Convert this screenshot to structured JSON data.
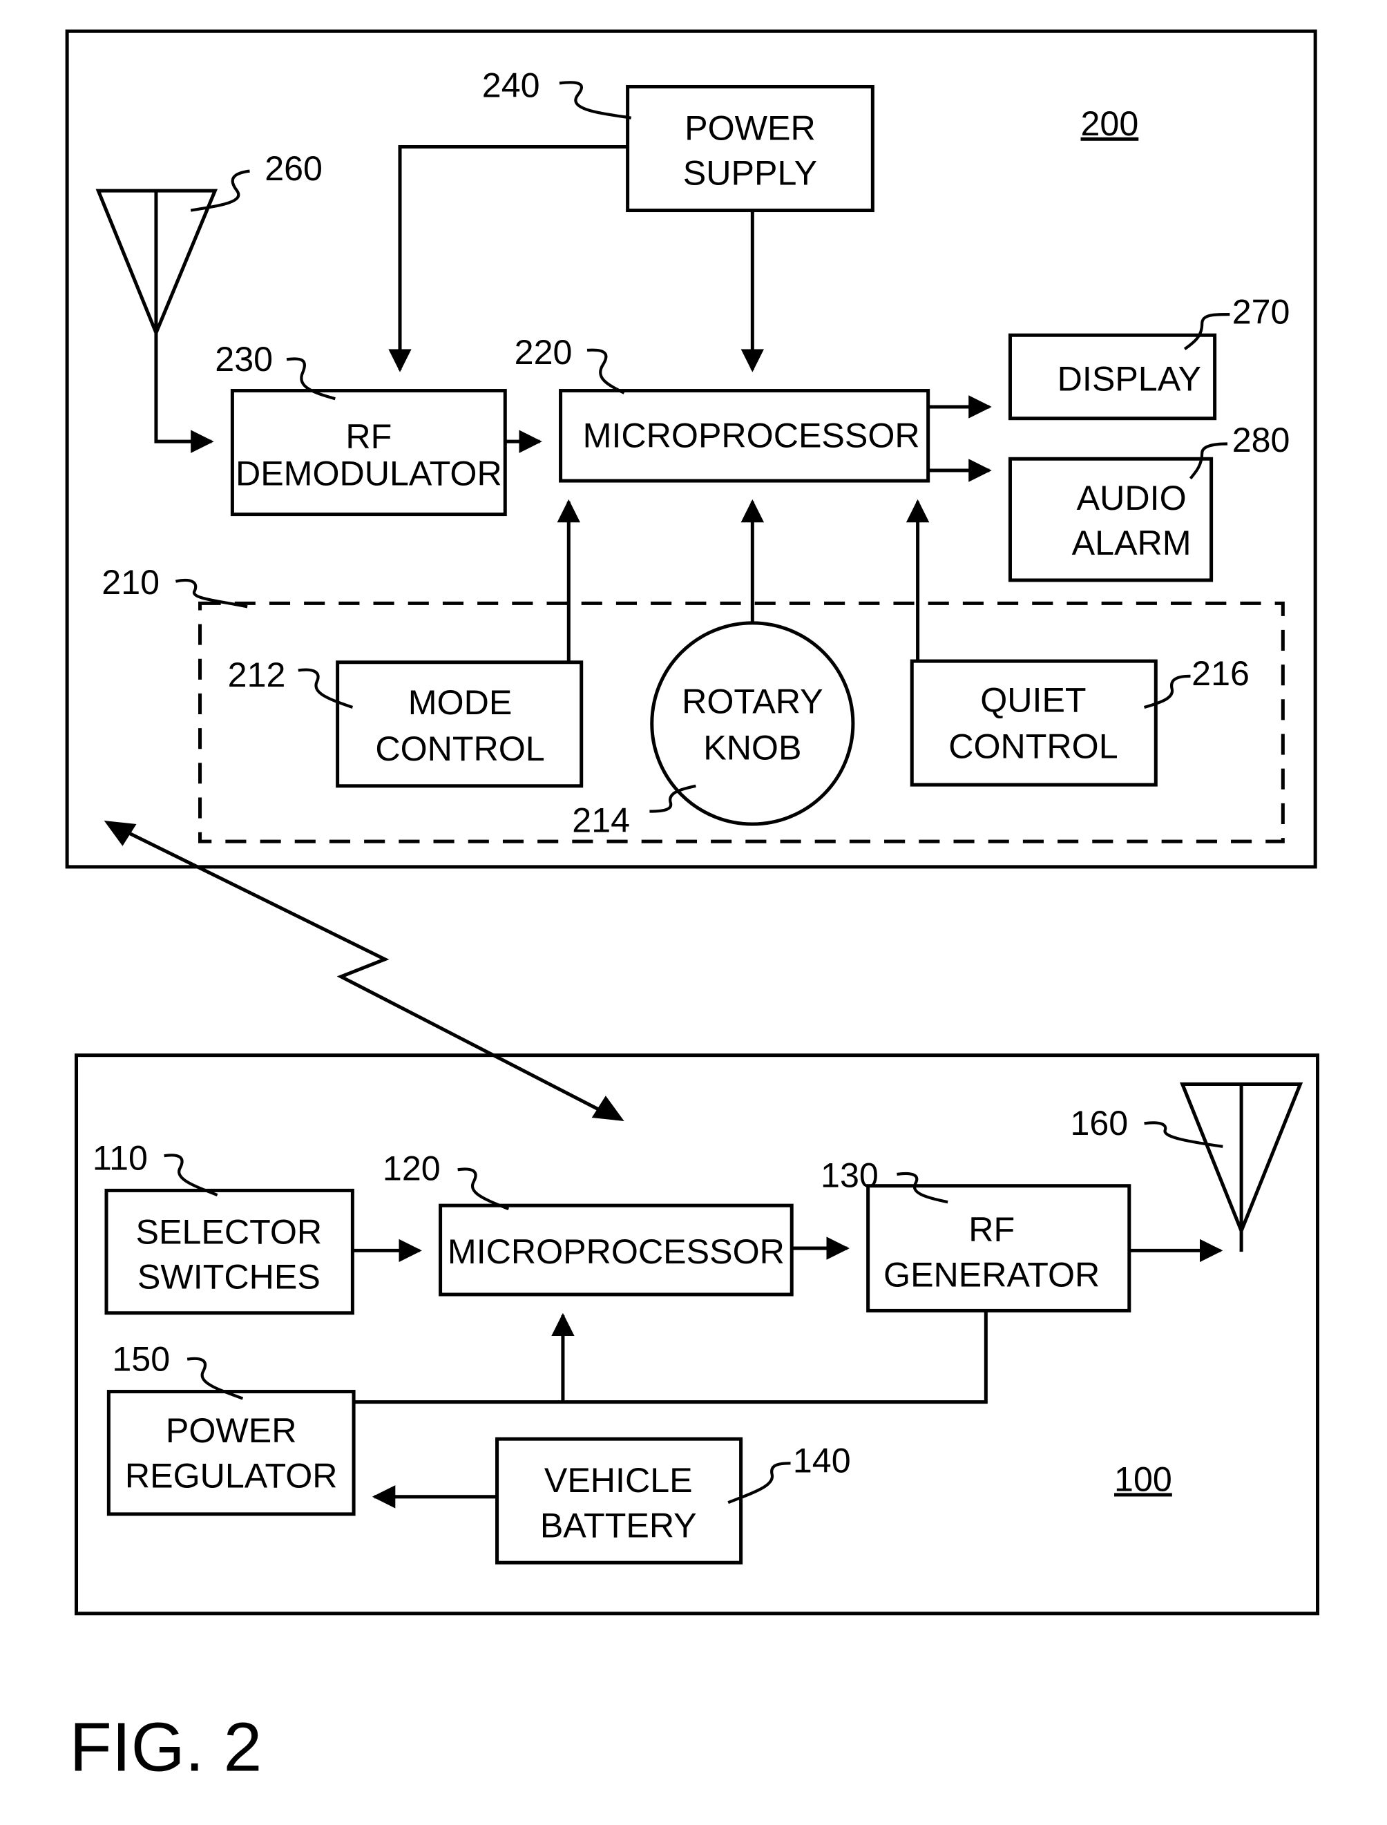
{
  "figure_label": "FIG. 2",
  "receiver": {
    "ref": "200",
    "blocks": {
      "power_supply": {
        "ref": "240",
        "lines": [
          "POWER",
          "SUPPLY"
        ]
      },
      "antenna": {
        "ref": "260"
      },
      "rf_demodulator": {
        "ref": "230",
        "lines": [
          "RF",
          "DEMODULATOR"
        ]
      },
      "microprocessor": {
        "ref": "220",
        "lines": [
          "MICROPROCESSOR"
        ]
      },
      "display": {
        "ref": "270",
        "lines": [
          "DISPLAY"
        ]
      },
      "audio_alarm": {
        "ref": "280",
        "lines": [
          "AUDIO",
          "ALARM"
        ]
      },
      "controls_group": {
        "ref": "210"
      },
      "mode_control": {
        "ref": "212",
        "lines": [
          "MODE",
          "CONTROL"
        ]
      },
      "rotary_knob": {
        "ref": "214",
        "lines": [
          "ROTARY",
          "KNOB"
        ]
      },
      "quiet_control": {
        "ref": "216",
        "lines": [
          "QUIET",
          "CONTROL"
        ]
      }
    }
  },
  "transmitter": {
    "ref": "100",
    "blocks": {
      "selector_switches": {
        "ref": "110",
        "lines": [
          "SELECTOR",
          "SWITCHES"
        ]
      },
      "microprocessor": {
        "ref": "120",
        "lines": [
          "MICROPROCESSOR"
        ]
      },
      "rf_generator": {
        "ref": "130",
        "lines": [
          "RF",
          "GENERATOR"
        ]
      },
      "antenna": {
        "ref": "160"
      },
      "vehicle_battery": {
        "ref": "140",
        "lines": [
          "VEHICLE",
          "BATTERY"
        ]
      },
      "power_regulator": {
        "ref": "150",
        "lines": [
          "POWER",
          "REGULATOR"
        ]
      }
    }
  }
}
